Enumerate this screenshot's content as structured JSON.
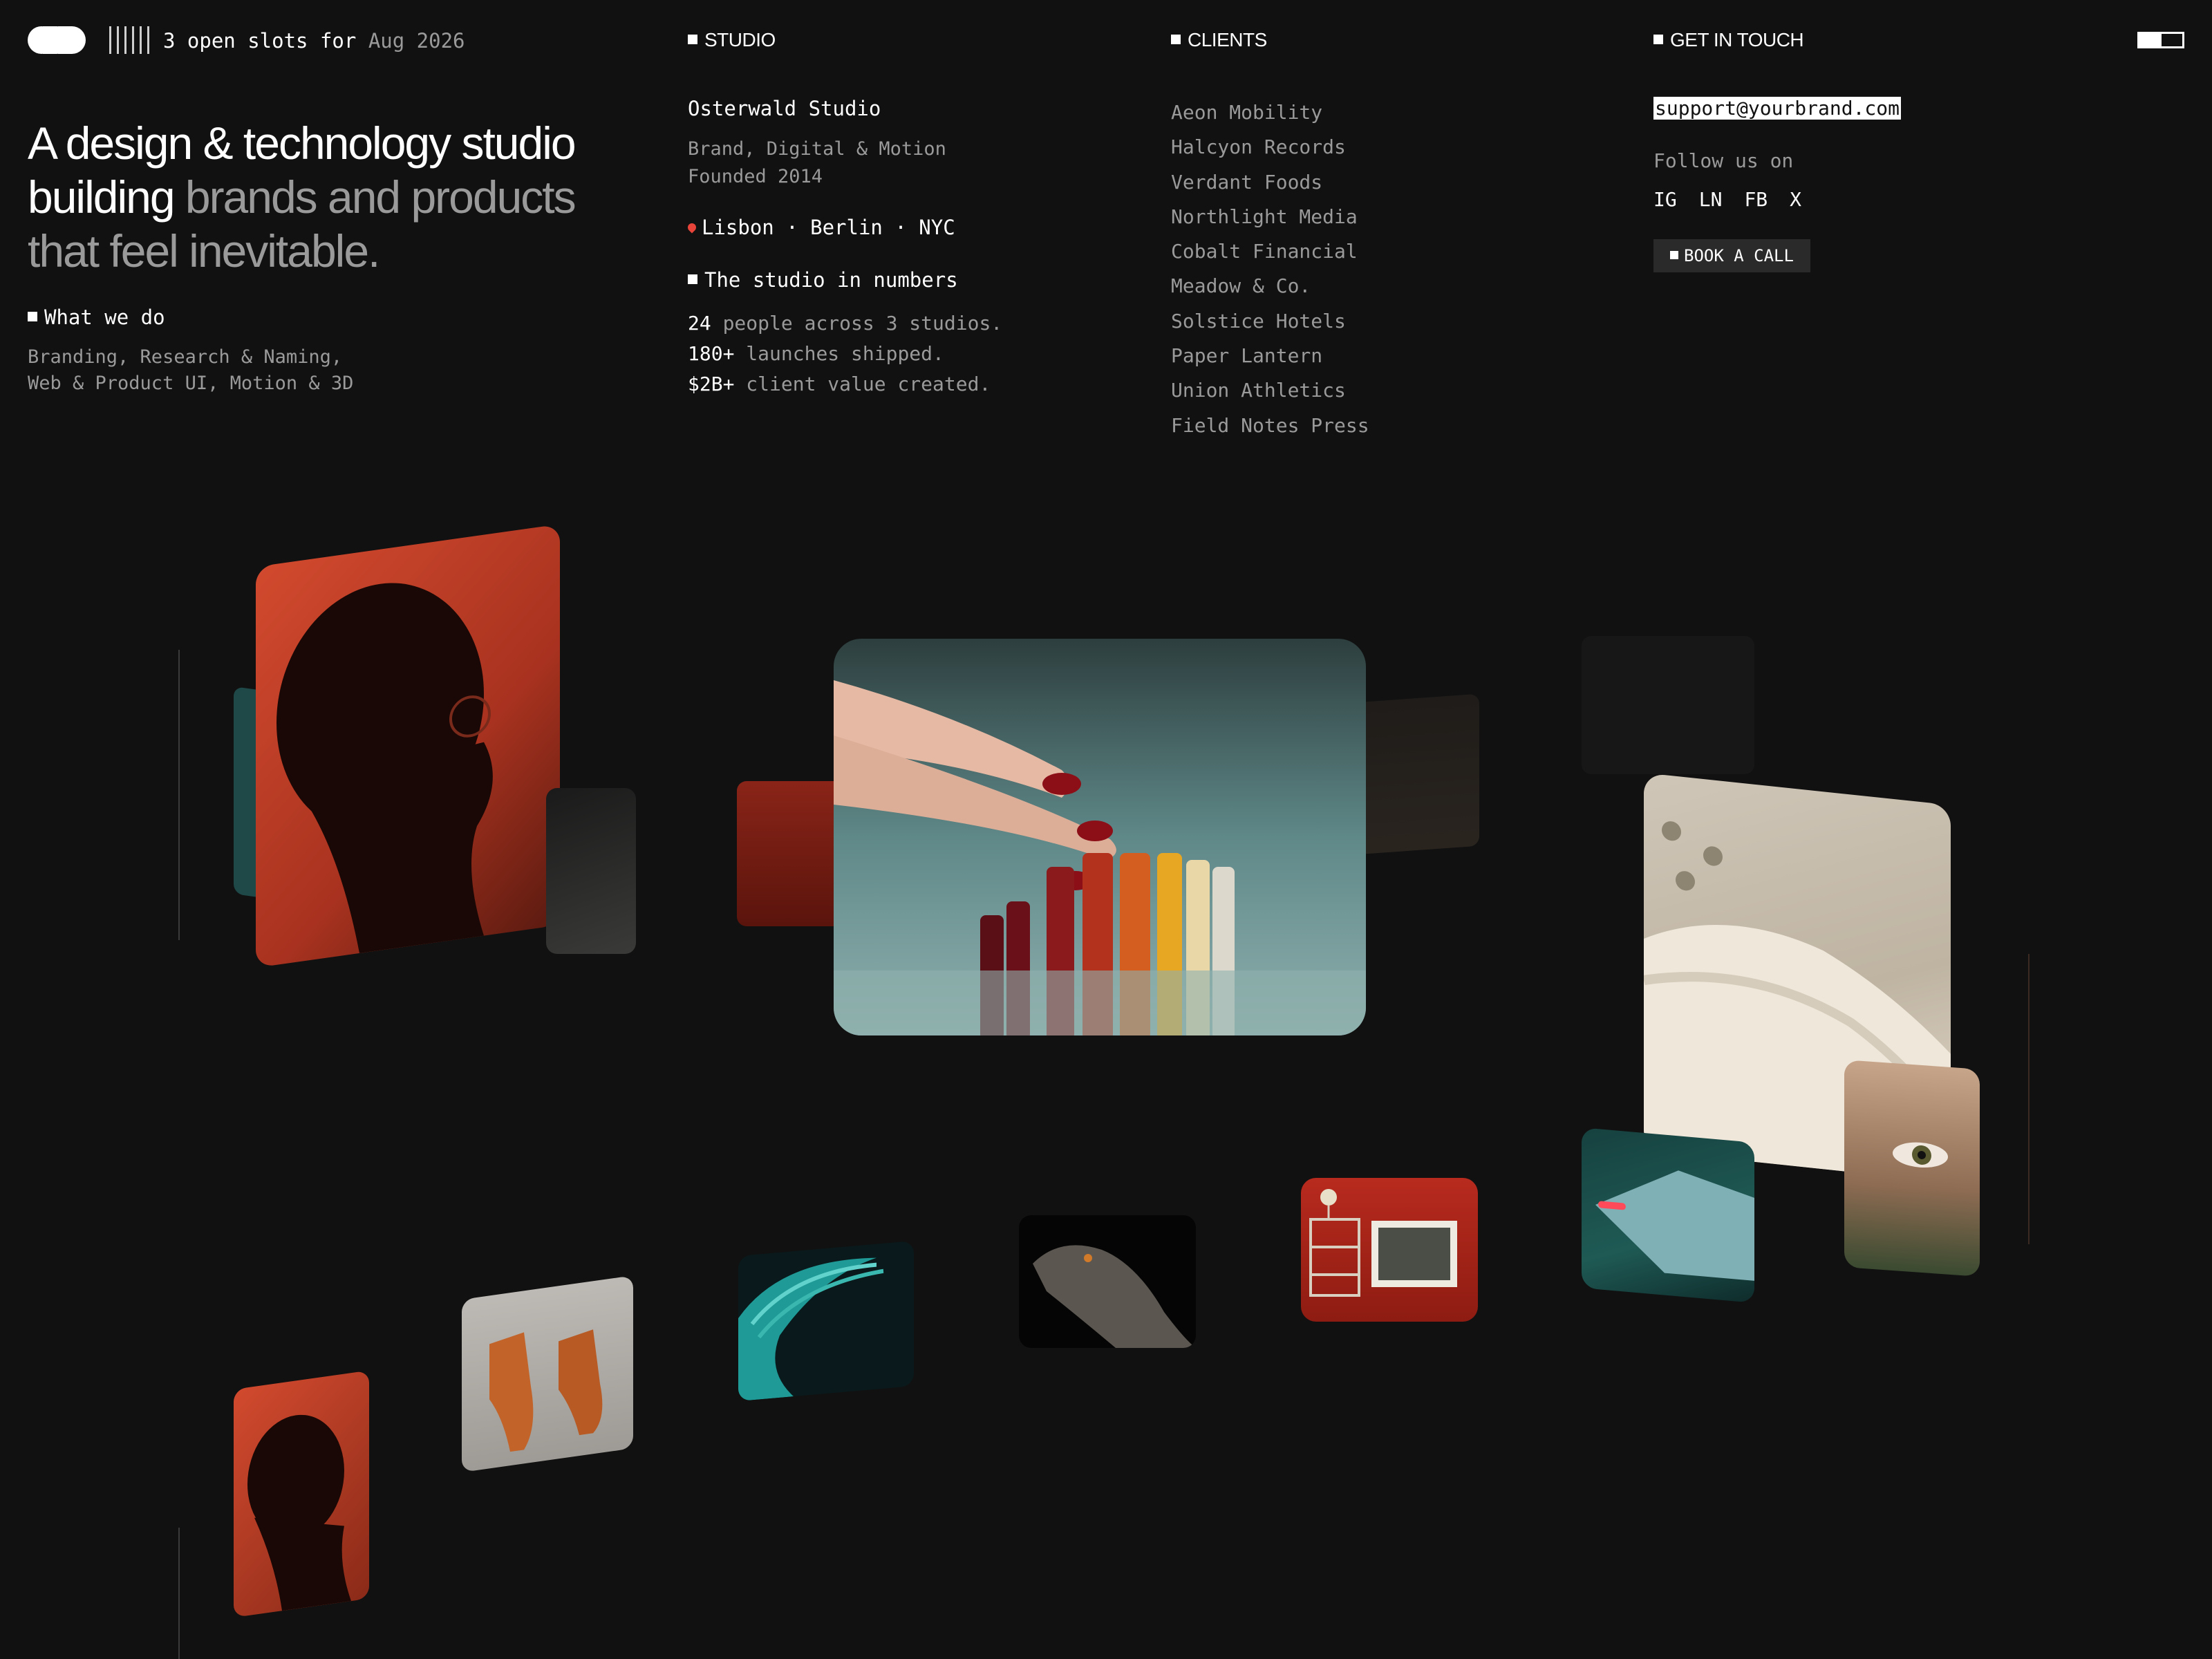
{
  "header": {
    "slots_prefix": "3 open slots for",
    "slots_date": "Aug 2026",
    "studio_heading": "STUDIO",
    "clients_heading": "CLIENTS",
    "contact_heading": "GET IN TOUCH"
  },
  "hero": {
    "headline_bright": "A design & technology studio building",
    "headline_dim": "brands and products that feel inevitable.",
    "what_heading": "What we do",
    "services_line1": "Branding, Research & Naming,",
    "services_line2": "Web & Product UI, Motion & 3D"
  },
  "studio": {
    "name": "Osterwald Studio",
    "disciplines": "Brand, Digital & Motion",
    "founded": "Founded 2014",
    "locations": "Lisbon · Berlin · NYC",
    "numbers_heading": "The studio in numbers",
    "stats": [
      {
        "value": "24",
        "text": "people across 3 studios."
      },
      {
        "value": "180+",
        "text": "launches shipped."
      },
      {
        "value": "$2B+",
        "text": "client value created."
      }
    ]
  },
  "clients": [
    "Aeon Mobility",
    "Halcyon Records",
    "Verdant Foods",
    "Northlight Media",
    "Cobalt Financial",
    "Meadow & Co.",
    "Solstice Hotels",
    "Paper Lantern",
    "Union Athletics",
    "Field Notes Press"
  ],
  "contact": {
    "email": "support@yourbrand.com",
    "follow": "Follow us on",
    "socials": [
      "IG",
      "LN",
      "FB",
      "X"
    ],
    "book": "BOOK A CALL"
  },
  "gallery": [
    "portrait-red-card",
    "nail-polish-card",
    "sneaker-card",
    "iguana-card",
    "teal-wave-card",
    "boots-card",
    "shelf-card",
    "spaceship-card",
    "eye-card"
  ],
  "colors": {
    "background": "#111111",
    "text": "#ffffff",
    "muted": "#9a9a9a",
    "accent_red": "#c8432e",
    "accent_teal": "#2aa9a4"
  }
}
